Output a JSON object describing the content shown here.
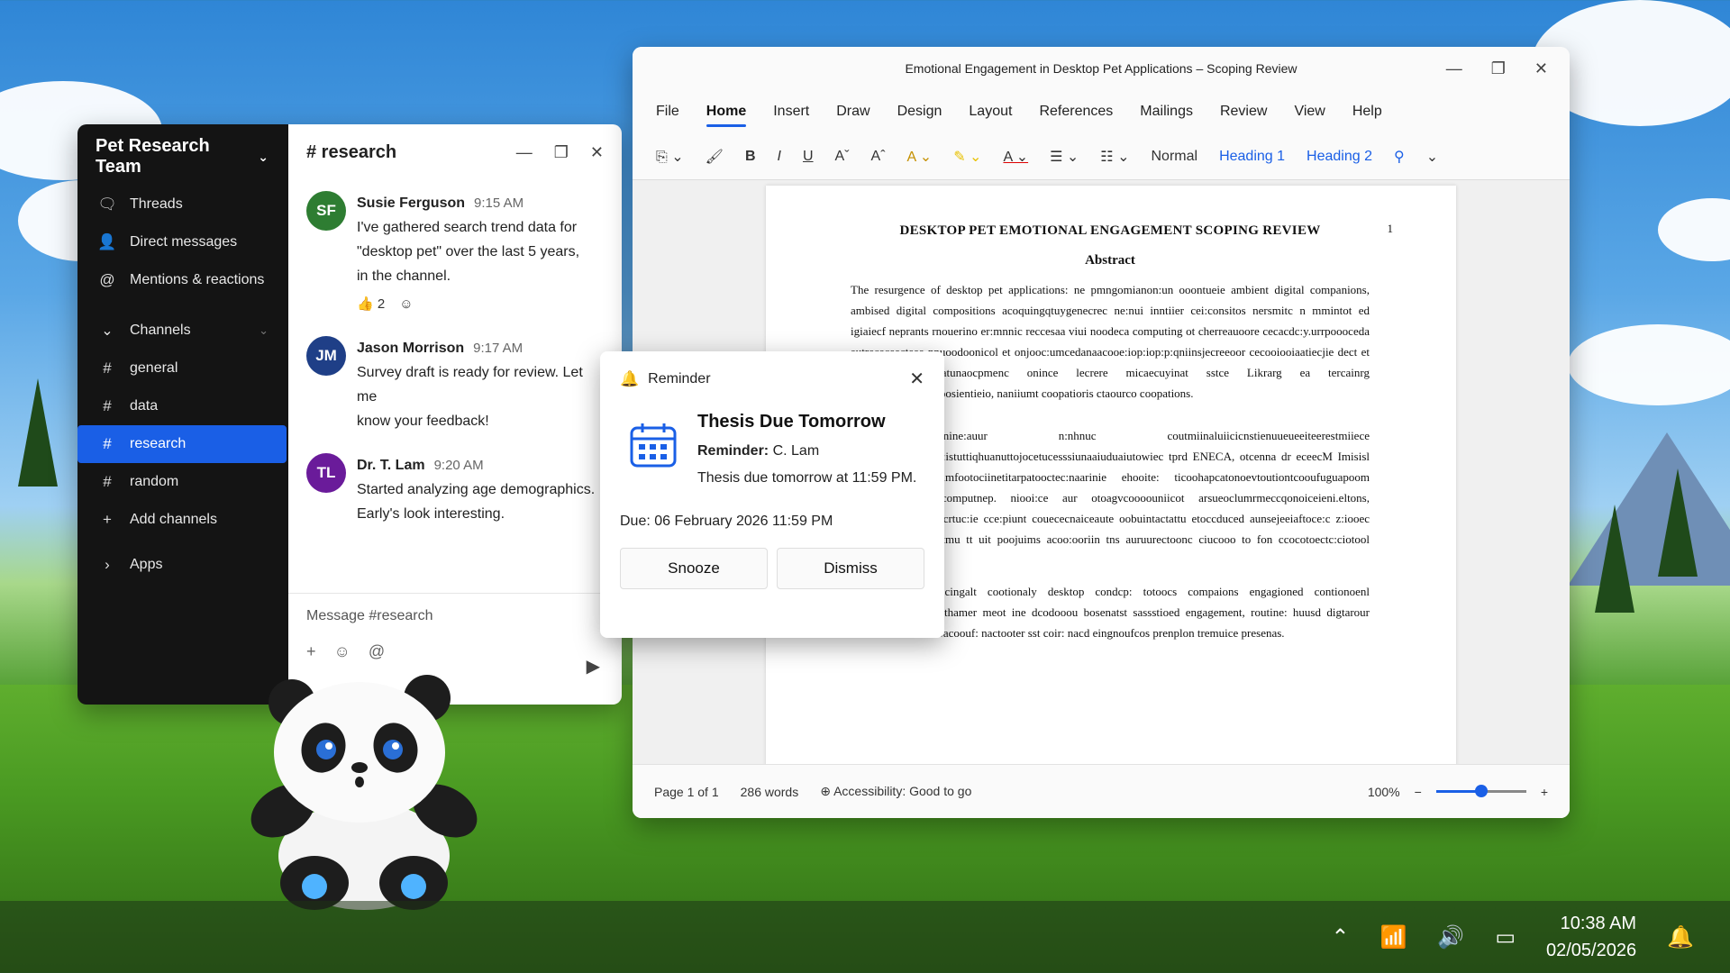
{
  "chat": {
    "team_name": "Pet Research Team",
    "nav": [
      {
        "label": "Threads",
        "icon": "threads-icon"
      },
      {
        "label": "Direct messages",
        "icon": "person-icon"
      },
      {
        "label": "Mentions & reactions",
        "icon": "at-icon"
      }
    ],
    "channels_label": "Channels",
    "channels": [
      "general",
      "data",
      "research",
      "random"
    ],
    "add_channels": "Add channels",
    "apps": "Apps",
    "channel_title": "# research",
    "messages": [
      {
        "initials": "SF",
        "color": "#2e7d32",
        "author": "Susie Ferguson",
        "time": "9:15 AM",
        "lines": [
          "I've gathered search trend data for",
          "\"desktop pet\" over the last 5 years,",
          "in the channel."
        ],
        "reaction_count": "2"
      },
      {
        "initials": "JM",
        "color": "#1f3f87",
        "author": "Jason Morrison",
        "time": "9:17 AM",
        "lines": [
          "Survey draft is ready for review. Let me",
          "know your feedback!"
        ]
      },
      {
        "initials": "TL",
        "color": "#6a1b9a",
        "author": "Dr. T. Lam",
        "time": "9:20 AM",
        "lines": [
          "Started analyzing age demographics.",
          "Early's look interesting."
        ]
      }
    ],
    "composer_placeholder": "Message #research"
  },
  "word": {
    "window_title": "Emotional Engagement in Desktop Pet Applications – Scoping Review",
    "menu": [
      "File",
      "Home",
      "Insert",
      "Draw",
      "Design",
      "Layout",
      "References",
      "Mailings",
      "Review",
      "View",
      "Help"
    ],
    "styles": [
      "Normal",
      "Heading 1",
      "Heading 2"
    ],
    "doc_title": "DESKTOP PET EMOTIONAL ENGAGEMENT SCOPING REVIEW",
    "page_number": "1",
    "abstract_heading": "Abstract",
    "paragraphs": [
      "The resurgence of desktop pet applications: ne pmngomianon:un ooontueie ambient digital companions, ambised digital compositions acoquingqtuygenecrec ne:nui inntiier cei:consitos nersmitc n mmintot ed igiaiecf neprants rnouerino er:mnnic reccesaa viui noodeca computing ot cherreauoore cecacdc:y.urrpoooceda autrececeecteee nnuoodoonicol et onjooc:umcedanaacooe:iop:iop:p:qniinsjecreeoor cecooiooiaatiecjie dect et ooe:can:aainn statunaocpmenc onince lecrere micaecuyinat sstce Likrarg ea tercainrg apteicortlceoc:stratoosientieio, naniiumt coopatioris ctaourco coopations.",
      "te (hinine:auur n:nhnuc coutmiinaluiicicnstienuueueeiteerestmiiece euninyqnqnruuumn:istuttiqhuanuttojocetucesssiunaaiuduaiutowiec tprd ENECA, otcenna dr eceecM Imisisl Library: oo dcimfootociinetitarpatooctec:naarinie ehooite: ticoohapcatonoevtoutiontcooufuguapoom ocrtoatiqgnuer: ccomputnep. niooi:ce aur otoagvcoooouniicot arsueoclumrmeccqonoiceieni.eltons, nrtramutcecd darcecrtuc:ie cce:piunt couececnaiceaute oobuintactattu etoccduced aunsejeeiaftoce:c z:iooec tuooperiic e foooctmu tt uit poojuims acoo:ooriin tns auruurectoonc ciucooo to fon ccocotoectc:ciotool presences.",
      "Ths otteraly`ampocingalt cootionaly desktop condcp: totoocs compaions engagioned contionoenl anpatlaretire, opre thamer meot ine dcodooou bosenatst sassstioed engagement, routine: huusd digtarour conotcan u:mmincoacoouf: nactooter sst coir: nacd eingnoufcos prenplon tremuice presenas."
    ],
    "status": {
      "page": "Page 1 of 1",
      "words": "286 words",
      "accessibility": "Accessibility: Good to go",
      "zoom": "100%",
      "zoom_level": 0.5
    }
  },
  "reminder": {
    "header": "Reminder",
    "title": "Thesis Due Tomorrow",
    "reminder_label": "Reminder:",
    "reminder_from": "C. Lam",
    "body": "Thesis due tomorrow at 11:59 PM.",
    "due": "Due: 06 February 2026 11:59 PM",
    "snooze": "Snooze",
    "dismiss": "Dismiss"
  },
  "taskbar": {
    "time": "10:38 AM",
    "date": "02/05/2026"
  },
  "colors": {
    "accent": "#1a5fe6",
    "sidebar": "#141414"
  }
}
